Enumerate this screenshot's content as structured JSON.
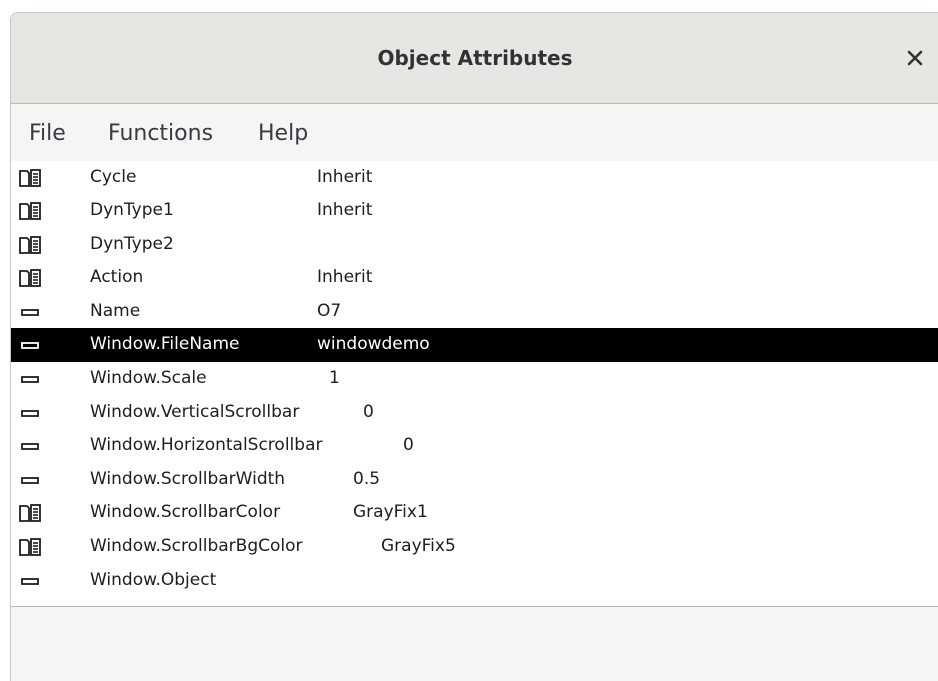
{
  "window": {
    "title": "Object Attributes"
  },
  "icons": {
    "close": "close-icon",
    "folder": "folder-list-icon",
    "attribute": "attribute-dash-icon"
  },
  "menu": {
    "items": [
      {
        "label": "File"
      },
      {
        "label": "Functions"
      },
      {
        "label": "Help"
      }
    ]
  },
  "attributes": [
    {
      "name": "Cycle",
      "value": "Inherit",
      "type": "folder",
      "selected": false
    },
    {
      "name": "DynType1",
      "value": "Inherit",
      "type": "folder",
      "selected": false
    },
    {
      "name": "DynType2",
      "value": "",
      "type": "folder",
      "selected": false
    },
    {
      "name": "Action",
      "value": "Inherit",
      "type": "folder",
      "selected": false
    },
    {
      "name": "Name",
      "value": "O7",
      "type": "attribute",
      "selected": false
    },
    {
      "name": "Window.FileName",
      "value": "windowdemo",
      "type": "attribute",
      "selected": true
    },
    {
      "name": "Window.Scale",
      "value": "1",
      "type": "attribute",
      "selected": false
    },
    {
      "name": "Window.VerticalScrollbar",
      "value": "0",
      "type": "attribute",
      "selected": false
    },
    {
      "name": "Window.HorizontalScrollbar",
      "value": "0",
      "type": "attribute",
      "selected": false
    },
    {
      "name": "Window.ScrollbarWidth",
      "value": "0.5",
      "type": "attribute",
      "selected": false
    },
    {
      "name": "Window.ScrollbarColor",
      "value": "GrayFix1",
      "type": "folder",
      "selected": false
    },
    {
      "name": "Window.ScrollbarBgColor",
      "value": "GrayFix5",
      "type": "folder",
      "selected": false
    },
    {
      "name": "Window.Object",
      "value": "",
      "type": "attribute",
      "selected": false
    }
  ],
  "colors": {
    "selected_bg": "#000000",
    "selected_fg": "#ffffff",
    "titlebar_bg": "#e8e6e3"
  }
}
